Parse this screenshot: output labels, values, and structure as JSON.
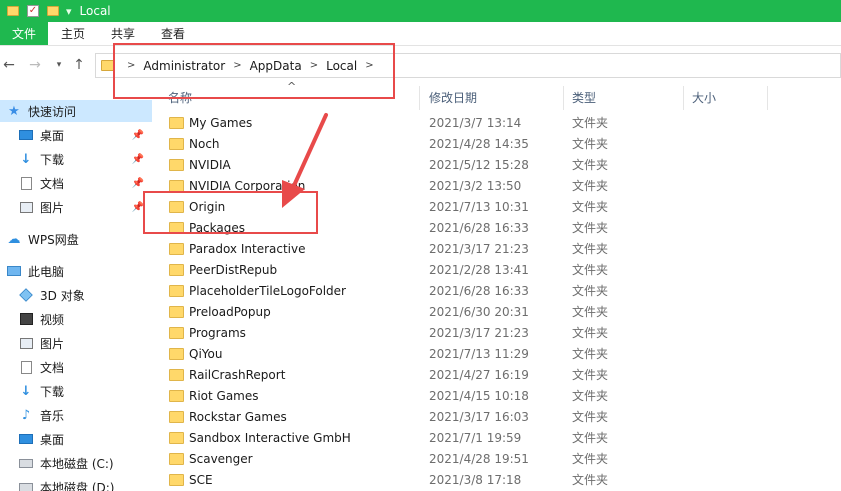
{
  "window": {
    "title": "Local"
  },
  "ribbon": {
    "tabs": [
      "文件",
      "主页",
      "共享",
      "查看"
    ]
  },
  "address": {
    "crumbs": [
      "Administrator",
      "AppData",
      "Local"
    ]
  },
  "columns": {
    "name": "名称",
    "modified": "修改日期",
    "type": "类型",
    "size": "大小"
  },
  "sidebar": {
    "items": [
      {
        "label": "快速访问",
        "icon": "star-icon",
        "pinned": false,
        "selected": true
      },
      {
        "label": "桌面",
        "icon": "desktop-icon",
        "pinned": true
      },
      {
        "label": "下载",
        "icon": "download-icon",
        "pinned": true
      },
      {
        "label": "文档",
        "icon": "document-icon",
        "pinned": true
      },
      {
        "label": "图片",
        "icon": "picture-icon",
        "pinned": true
      },
      {
        "label": "WPS网盘",
        "icon": "cloud-icon",
        "pinned": false
      },
      {
        "label": "此电脑",
        "icon": "computer-icon",
        "pinned": false
      },
      {
        "label": "3D 对象",
        "icon": "cube-icon",
        "pinned": false
      },
      {
        "label": "视频",
        "icon": "video-icon",
        "pinned": false
      },
      {
        "label": "图片",
        "icon": "picture-icon",
        "pinned": false
      },
      {
        "label": "文档",
        "icon": "document-icon",
        "pinned": false
      },
      {
        "label": "下载",
        "icon": "download-icon",
        "pinned": false
      },
      {
        "label": "音乐",
        "icon": "music-icon",
        "pinned": false
      },
      {
        "label": "桌面",
        "icon": "desktop-icon",
        "pinned": false
      },
      {
        "label": "本地磁盘 (C:)",
        "icon": "drive-icon",
        "pinned": false
      },
      {
        "label": "本地磁盘 (D:)",
        "icon": "drive-icon",
        "pinned": false
      }
    ]
  },
  "files": [
    {
      "name": "My Games",
      "modified": "2021/3/7 13:14",
      "type": "文件夹"
    },
    {
      "name": "Noch",
      "modified": "2021/4/28 14:35",
      "type": "文件夹"
    },
    {
      "name": "NVIDIA",
      "modified": "2021/5/12 15:28",
      "type": "文件夹"
    },
    {
      "name": "NVIDIA Corporation",
      "modified": "2021/3/2 13:50",
      "type": "文件夹"
    },
    {
      "name": "Origin",
      "modified": "2021/7/13 10:31",
      "type": "文件夹"
    },
    {
      "name": "Packages",
      "modified": "2021/6/28 16:33",
      "type": "文件夹"
    },
    {
      "name": "Paradox Interactive",
      "modified": "2021/3/17 21:23",
      "type": "文件夹"
    },
    {
      "name": "PeerDistRepub",
      "modified": "2021/2/28 13:41",
      "type": "文件夹"
    },
    {
      "name": "PlaceholderTileLogoFolder",
      "modified": "2021/6/28 16:33",
      "type": "文件夹"
    },
    {
      "name": "PreloadPopup",
      "modified": "2021/6/30 20:31",
      "type": "文件夹"
    },
    {
      "name": "Programs",
      "modified": "2021/3/17 21:23",
      "type": "文件夹"
    },
    {
      "name": "QiYou",
      "modified": "2021/7/13 11:29",
      "type": "文件夹"
    },
    {
      "name": "RailCrashReport",
      "modified": "2021/4/27 16:19",
      "type": "文件夹"
    },
    {
      "name": "Riot Games",
      "modified": "2021/4/15 10:18",
      "type": "文件夹"
    },
    {
      "name": "Rockstar Games",
      "modified": "2021/3/17 16:03",
      "type": "文件夹"
    },
    {
      "name": "Sandbox Interactive GmbH",
      "modified": "2021/7/1 19:59",
      "type": "文件夹"
    },
    {
      "name": "Scavenger",
      "modified": "2021/4/28 19:51",
      "type": "文件夹"
    },
    {
      "name": "SCE",
      "modified": "2021/3/8 17:18",
      "type": "文件夹"
    }
  ],
  "colors": {
    "accent": "#1fb84f",
    "annotation": "#e84a4a",
    "folder": "#ffd86a",
    "selected": "#cce8ff"
  }
}
